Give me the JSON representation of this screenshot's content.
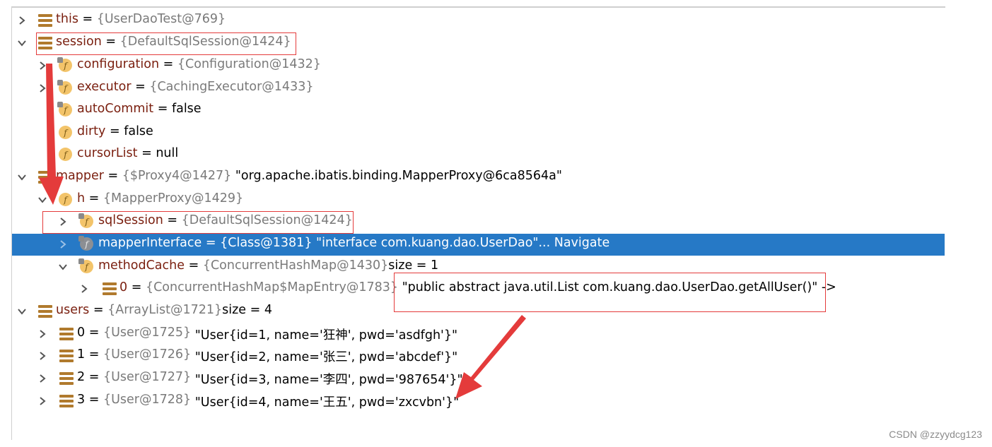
{
  "variables": [
    {
      "name": "this",
      "type": "{UserDaoTest@769}",
      "expanded": false
    },
    {
      "name": "session",
      "type": "{DefaultSqlSession@1424}",
      "expanded": true
    },
    {
      "name": "configuration",
      "type": "{Configuration@1432}",
      "expanded": false
    },
    {
      "name": "executor",
      "type": "{CachingExecutor@1433}",
      "expanded": false
    },
    {
      "name": "autoCommit",
      "value": "false"
    },
    {
      "name": "dirty",
      "value": "false"
    },
    {
      "name": "cursorList",
      "value": "null"
    },
    {
      "name": "mapper",
      "type": "{$Proxy4@1427}",
      "value": "\"org.apache.ibatis.binding.MapperProxy@6ca8564a\"",
      "expanded": true
    },
    {
      "name": "h",
      "type": "{MapperProxy@1429}",
      "expanded": true
    },
    {
      "name": "sqlSession",
      "type": "{DefaultSqlSession@1424}",
      "expanded": false
    },
    {
      "name": "mapperInterface",
      "type": "{Class@1381}",
      "value": "\"interface com.kuang.dao.UserDao\"...",
      "action": "Navigate",
      "selected": true
    },
    {
      "name": "methodCache",
      "type": "{ConcurrentHashMap@1430}",
      "value": " size = 1",
      "expanded": true
    },
    {
      "name": "0",
      "type": "{ConcurrentHashMap$MapEntry@1783}",
      "value": "\"public abstract java.util.List com.kuang.dao.UserDao.getAllUser()\" ->",
      "expanded": false
    },
    {
      "name": "users",
      "type": "{ArrayList@1721}",
      "value": " size = 4",
      "expanded": true
    },
    {
      "name": "0",
      "type": "{User@1725}",
      "value": "\"User{id=1, name='狂神', pwd='asdfgh'}\"",
      "expanded": false
    },
    {
      "name": "1",
      "type": "{User@1726}",
      "value": "\"User{id=2, name='张三', pwd='abcdef'}\"",
      "expanded": false
    },
    {
      "name": "2",
      "type": "{User@1727}",
      "value": "\"User{id=3, name='李四', pwd='987654'}\"",
      "expanded": false
    },
    {
      "name": "3",
      "type": "{User@1728}",
      "value": "\"User{id=4, name='王五', pwd='zxcvbn'}\"",
      "expanded": false
    }
  ],
  "watermark": "CSDN @zzyydcg123",
  "colors": {
    "selection": "#2679c6",
    "annotation": "#e43b3b",
    "field_name": "#7a1f0f",
    "type_text": "#7a7a7a"
  }
}
